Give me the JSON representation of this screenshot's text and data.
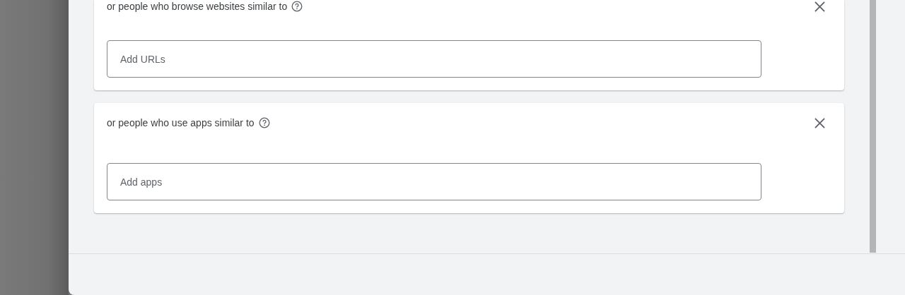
{
  "cards": [
    {
      "title": "or people who browse websites similar to",
      "placeholder": "Add URLs"
    },
    {
      "title": "or people who use apps similar to",
      "placeholder": "Add apps"
    }
  ]
}
